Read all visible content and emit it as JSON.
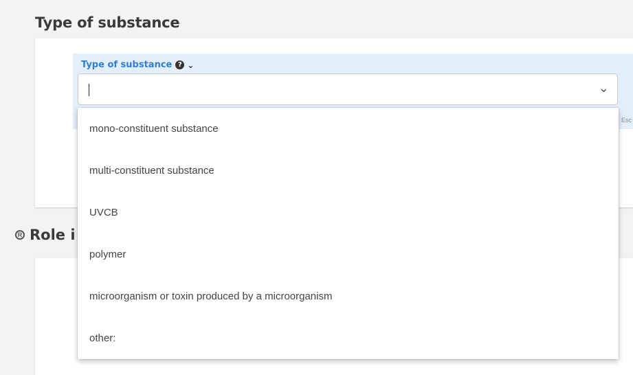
{
  "section": {
    "title": "Type of substance"
  },
  "field": {
    "label": "Type of substance",
    "help_icon": "question-circle-icon",
    "label_chevron": "chevron-down-icon",
    "value": "",
    "select_chevron": "chevron-down-icon",
    "hint": "Esc"
  },
  "role_section": {
    "title": "Role i",
    "icon": "role-icon"
  },
  "dropdown": {
    "options": [
      {
        "label": "mono-constituent substance"
      },
      {
        "label": "multi-constituent substance"
      },
      {
        "label": "UVCB"
      },
      {
        "label": "polymer"
      },
      {
        "label": "microorganism or toxin produced by a microorganism"
      },
      {
        "label": "other:"
      }
    ]
  }
}
